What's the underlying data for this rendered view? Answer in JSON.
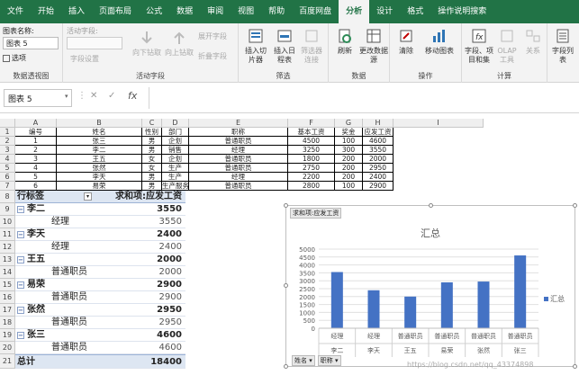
{
  "ribbon": {
    "tabs": [
      {
        "label": "文件"
      },
      {
        "label": "开始"
      },
      {
        "label": "插入"
      },
      {
        "label": "页面布局"
      },
      {
        "label": "公式"
      },
      {
        "label": "数据"
      },
      {
        "label": "审阅"
      },
      {
        "label": "视图"
      },
      {
        "label": "帮助"
      },
      {
        "label": "百度网盘"
      },
      {
        "label": "分析",
        "active": true
      },
      {
        "label": "设计"
      },
      {
        "label": "格式"
      },
      {
        "label": "操作说明搜索"
      }
    ],
    "chart_name_label": "图表名称:",
    "chart_name_value": "图表 5",
    "options_label": "选项",
    "active_field_label": "活动字段:",
    "field_settings_label": "字段设置",
    "drill_down_label": "向下钻取",
    "drill_up_label": "向上钻取",
    "expand_field_label": "展开字段",
    "collapse_field_label": "折叠字段",
    "insert_slicer_label": "插入切片器",
    "insert_timeline_label": "插入日程表",
    "filter_conn_label": "筛选器连接",
    "refresh_label": "刷新",
    "change_source_label": "更改数据源",
    "clear_label": "清除",
    "move_chart_label": "移动图表",
    "fields_items_label": "字段、项目和集",
    "olap_label": "OLAP工具",
    "relationships_label": "关系",
    "field_list_label": "字段列表",
    "groups": {
      "pivotchart": "数据透视图",
      "active_field": "活动字段",
      "filter": "筛选",
      "data": "数据",
      "actions": "操作",
      "calc": "计算"
    }
  },
  "formula_bar": {
    "name_box": "图表 5",
    "cancel": "✕",
    "enter": "✓",
    "fx": "fx",
    "menu_dots": "⋮"
  },
  "columns": [
    "A",
    "B",
    "C",
    "D",
    "E",
    "F",
    "G",
    "H",
    "I"
  ],
  "rows": [
    "1",
    "2",
    "3",
    "4",
    "5",
    "6",
    "7",
    "8",
    "9",
    "10",
    "11",
    "12",
    "13",
    "14",
    "15",
    "16",
    "17",
    "18",
    "19",
    "20",
    "21"
  ],
  "data_table": {
    "headers": [
      "编号",
      "姓名",
      "性别",
      "部门",
      "职称",
      "基本工资",
      "奖金",
      "应发工资"
    ],
    "rows": [
      [
        "1",
        "张三",
        "男",
        "企划",
        "普通职员",
        "4500",
        "100",
        "4600"
      ],
      [
        "2",
        "李二",
        "男",
        "销售",
        "经理",
        "3250",
        "300",
        "3550"
      ],
      [
        "3",
        "王五",
        "女",
        "企划",
        "普通职员",
        "1800",
        "200",
        "2000"
      ],
      [
        "4",
        "张然",
        "女",
        "生产",
        "普通职员",
        "2750",
        "200",
        "2950"
      ],
      [
        "5",
        "李天",
        "男",
        "生产",
        "经理",
        "2200",
        "200",
        "2400"
      ],
      [
        "6",
        "易荣",
        "男",
        "生产服务",
        "普通职员",
        "2800",
        "100",
        "2900"
      ]
    ]
  },
  "pivot": {
    "header_label": "行标签",
    "header_value": "求和项:应发工资",
    "items": [
      {
        "type": "group",
        "name": "李二",
        "value": "3550"
      },
      {
        "type": "detail",
        "name": "经理",
        "value": "3550"
      },
      {
        "type": "group",
        "name": "李天",
        "value": "2400"
      },
      {
        "type": "detail",
        "name": "经理",
        "value": "2400"
      },
      {
        "type": "group",
        "name": "王五",
        "value": "2000"
      },
      {
        "type": "detail",
        "name": "普通职员",
        "value": "2000"
      },
      {
        "type": "group",
        "name": "易荣",
        "value": "2900"
      },
      {
        "type": "detail",
        "name": "普通职员",
        "value": "2900"
      },
      {
        "type": "group",
        "name": "张然",
        "value": "2950"
      },
      {
        "type": "detail",
        "name": "普通职员",
        "value": "2950"
      },
      {
        "type": "group",
        "name": "张三",
        "value": "4600"
      },
      {
        "type": "detail",
        "name": "普通职员",
        "value": "4600"
      }
    ],
    "total_label": "总计",
    "total_value": "18400"
  },
  "chart": {
    "field_button": "求和项:应发工资",
    "title": "汇总",
    "legend": "汇总",
    "filter_buttons": [
      "姓名 ▾",
      "职称 ▾"
    ]
  },
  "chart_data": {
    "type": "bar",
    "title": "汇总",
    "categories_outer": [
      "李二",
      "李天",
      "王五",
      "易荣",
      "张然",
      "张三"
    ],
    "categories_inner": [
      "经理",
      "经理",
      "普通职员",
      "普通职员",
      "普通职员",
      "普通职员"
    ],
    "series": [
      {
        "name": "汇总",
        "values": [
          3550,
          2400,
          2000,
          2900,
          2950,
          4600
        ]
      }
    ],
    "ylim": [
      0,
      5000
    ],
    "yticks": [
      0,
      500,
      1000,
      1500,
      2000,
      2500,
      3000,
      3500,
      4000,
      4500,
      5000
    ],
    "color": "#4472c4",
    "legend_position": "right",
    "grid": true
  },
  "watermark": "https://blog.csdn.net/qq_43374898"
}
